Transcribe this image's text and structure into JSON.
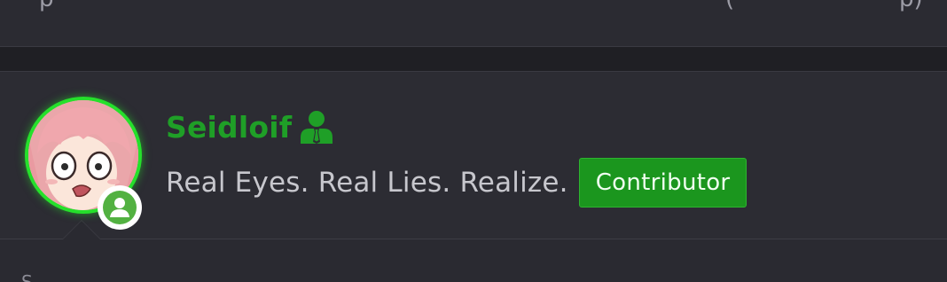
{
  "author": {
    "username": "Seidloif",
    "staff_icon": "user-tie-icon",
    "tagline": "Real Eyes. Real Lies. Realize.",
    "rank_badge": "Contributor",
    "avatar_icon": "avatar-image",
    "status_icon": "online-user-icon"
  },
  "colors": {
    "username": "#1f9f27",
    "badge_bg": "#1b961e",
    "avatar_ring": "#25e02b",
    "status": "#52b141",
    "background": "#2a2a31",
    "tagline": "#c7c7cd"
  }
}
